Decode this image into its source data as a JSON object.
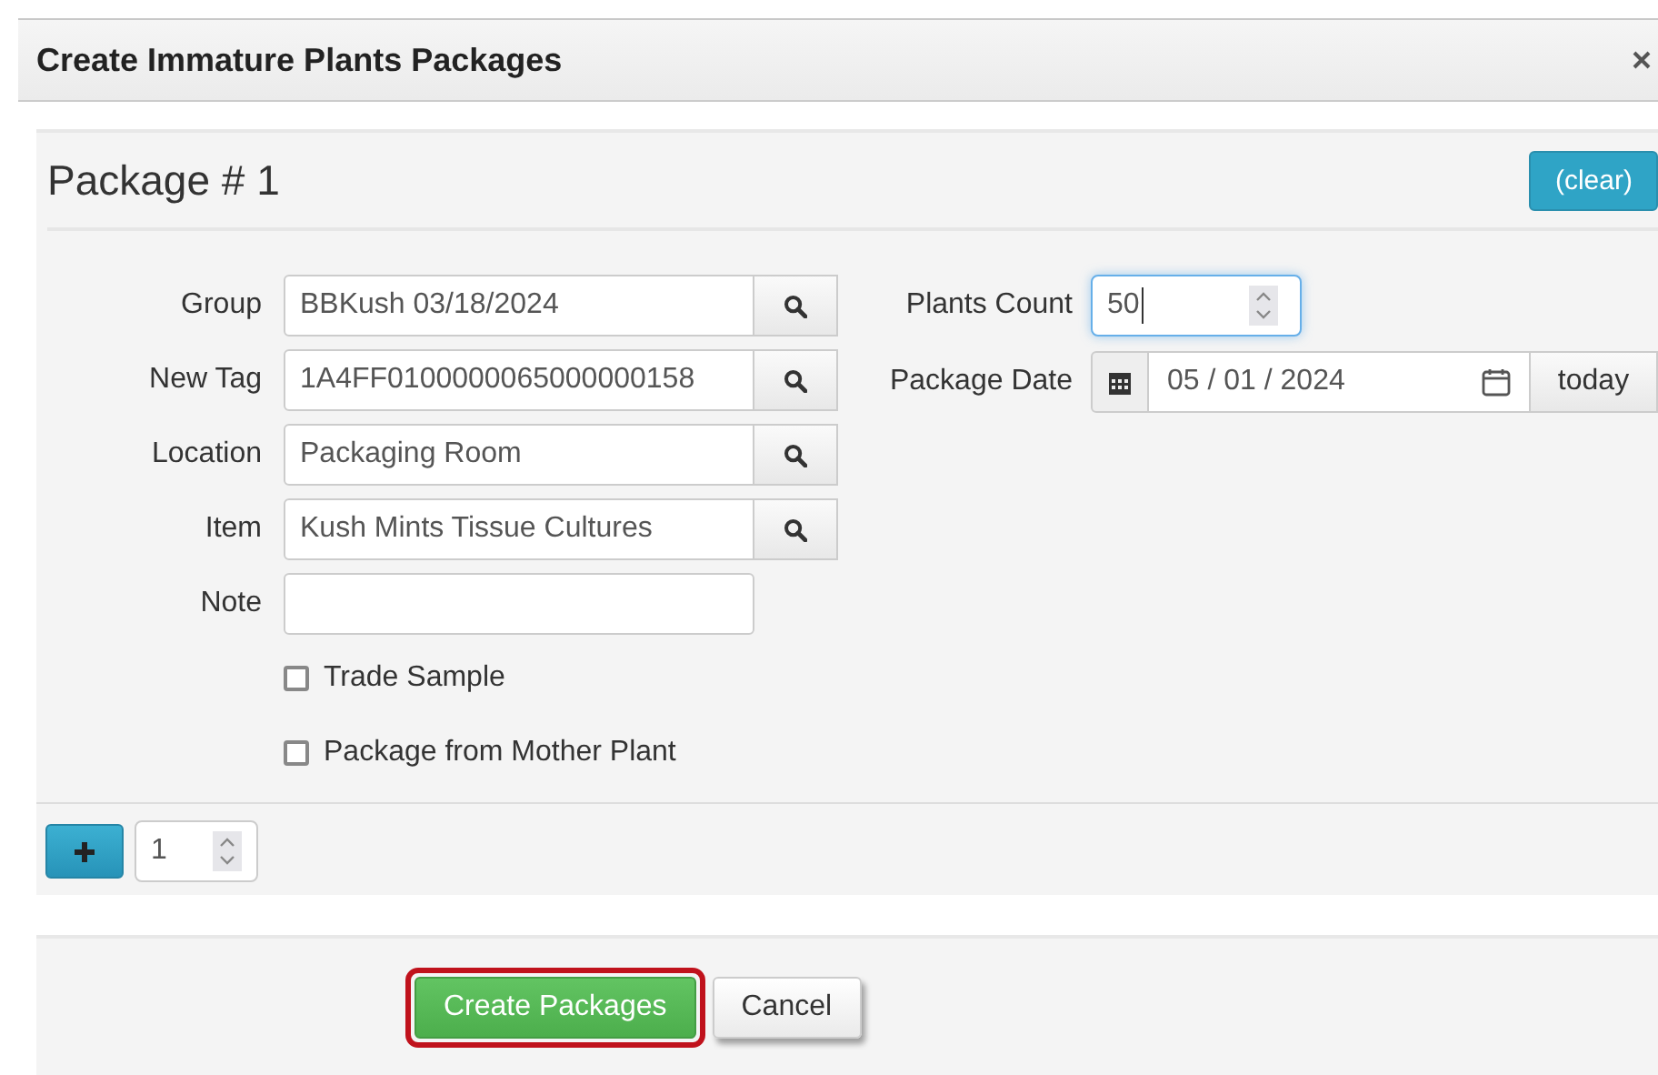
{
  "dialog": {
    "title": "Create Immature Plants Packages"
  },
  "package": {
    "heading": "Package # 1",
    "clear_button": "(clear)"
  },
  "fields": [
    {
      "label": "Group",
      "value": "BBKush 03/18/2024",
      "kind": "lookup"
    },
    {
      "label": "New Tag",
      "value": "1A4FF0100000065000000158",
      "kind": "lookup"
    },
    {
      "label": "Location",
      "value": "Packaging Room",
      "kind": "lookup"
    },
    {
      "label": "Item",
      "value": "Kush Mints Tissue Cultures",
      "kind": "lookup"
    },
    {
      "label": "Note",
      "kind": "text"
    }
  ],
  "options": [
    {
      "label": "Trade Sample",
      "checked": false
    },
    {
      "label": "Package from Mother Plant",
      "checked": false
    }
  ],
  "plants_count": {
    "label": "Plants Count",
    "value": "50",
    "focused": true
  },
  "package_date": {
    "label": "Package Date",
    "value": "05 / 01 / 2024",
    "today_button": "today"
  },
  "add_count": {
    "value": "1"
  },
  "buttons": [
    {
      "label": "Create Packages",
      "kind": "primary",
      "highlighted": true
    },
    {
      "label": "Cancel",
      "kind": "default",
      "highlighted": false
    }
  ]
}
